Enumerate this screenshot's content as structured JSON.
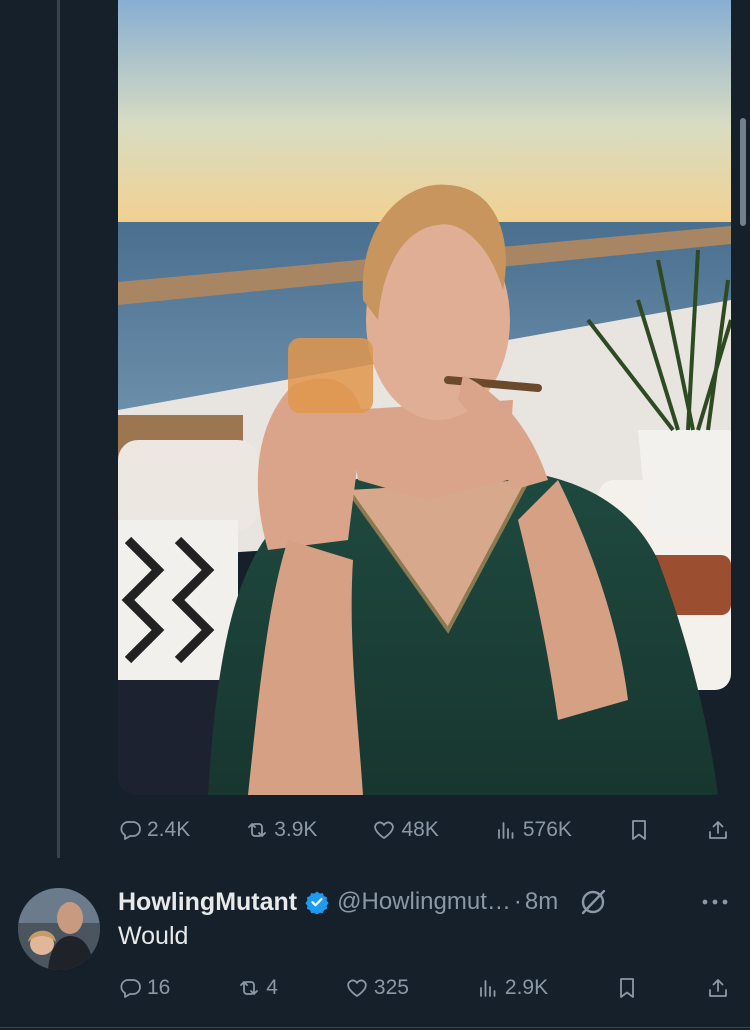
{
  "tweet": {
    "stats": {
      "replies": "2.4K",
      "retweets": "3.9K",
      "likes": "48K",
      "views": "576K"
    }
  },
  "reply": {
    "display_name": "HowlingMutant",
    "handle": "@Howlingmut…",
    "separator": "·",
    "time": "8m",
    "text": "Would",
    "stats": {
      "replies": "16",
      "retweets": "4",
      "likes": "325",
      "views": "2.9K"
    }
  },
  "colors": {
    "background": "#15202b",
    "text_primary": "#e7e9ea",
    "text_secondary": "#8b98a5",
    "verified": "#1d9bf0",
    "thread_line": "#38444d"
  },
  "icons": [
    "reply-icon",
    "retweet-icon",
    "like-icon",
    "views-icon",
    "bookmark-icon",
    "share-icon",
    "verified-badge-icon",
    "grok-icon",
    "more-icon"
  ]
}
